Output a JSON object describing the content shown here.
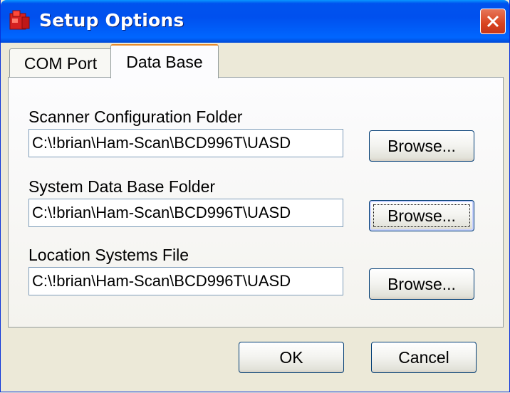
{
  "window": {
    "title": "Setup Options"
  },
  "tabs": [
    {
      "label": "COM Port",
      "active": false
    },
    {
      "label": "Data Base",
      "active": true
    }
  ],
  "fields": [
    {
      "label": "Scanner Configuration Folder",
      "value": "C:\\!brian\\Ham-Scan\\BCD996T\\UASD",
      "button": "Browse..."
    },
    {
      "label": "System Data Base Folder",
      "value": "C:\\!brian\\Ham-Scan\\BCD996T\\UASD",
      "button": "Browse..."
    },
    {
      "label": "Location Systems File",
      "value": "C:\\!brian\\Ham-Scan\\BCD996T\\UASD",
      "button": "Browse..."
    }
  ],
  "footer": {
    "ok_label": "OK",
    "cancel_label": "Cancel"
  },
  "icons": {
    "app": "app-icon",
    "close": "close-icon"
  },
  "colors": {
    "titlebar": "#0053ee",
    "close": "#d9431f",
    "tab_highlight": "#e68b2c",
    "dialog_bg": "#ece9d8"
  }
}
